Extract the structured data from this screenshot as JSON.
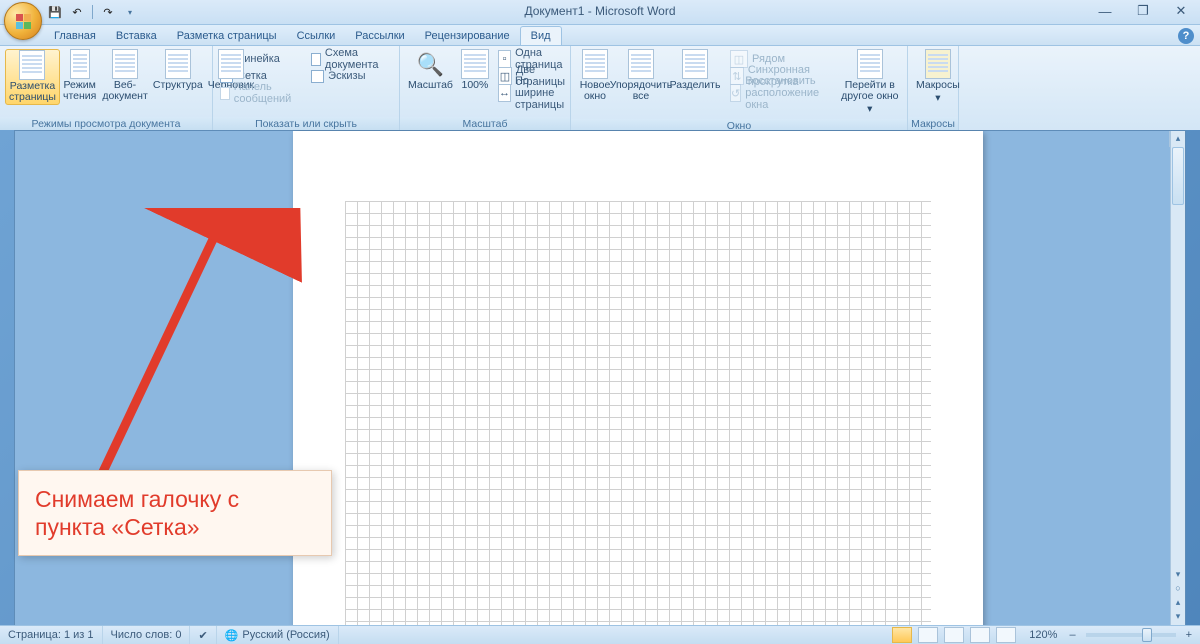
{
  "title": "Документ1 - Microsoft Word",
  "qat": {
    "save": "save",
    "undo": "undo",
    "redo": "redo"
  },
  "tabs": [
    "Главная",
    "Вставка",
    "Разметка страницы",
    "Ссылки",
    "Рассылки",
    "Рецензирование",
    "Вид"
  ],
  "active_tab": 6,
  "ribbon": {
    "views_group": "Режимы просмотра документа",
    "views": [
      "Разметка страницы",
      "Режим чтения",
      "Веб-документ",
      "Структура",
      "Черновик"
    ],
    "show_group": "Показать или скрыть",
    "show": {
      "ruler": "Линейка",
      "grid": "Сетка",
      "message_bar": "Панель сообщений",
      "doc_map": "Схема документа",
      "thumbnails": "Эскизы"
    },
    "zoom_group": "Масштаб",
    "zoom_btn": "Масштаб",
    "zoom_100": "100%",
    "one_page": "Одна страница",
    "two_pages": "Две страницы",
    "page_width": "По ширине страницы",
    "window_group": "Окно",
    "new_window": "Новое окно",
    "arrange_all": "Упорядочить все",
    "split": "Разделить",
    "side_by_side": "Рядом",
    "sync_scroll": "Синхронная прокрутка",
    "reset_pos": "Восстановить расположение окна",
    "switch": "Перейти в другое окно",
    "macros_group": "Макросы",
    "macros": "Макросы"
  },
  "annotation": "Снимаем галочку с пункта «Сетка»",
  "status": {
    "page": "Страница: 1 из 1",
    "words": "Число слов: 0",
    "lang": "Русский (Россия)",
    "zoom": "120%"
  }
}
